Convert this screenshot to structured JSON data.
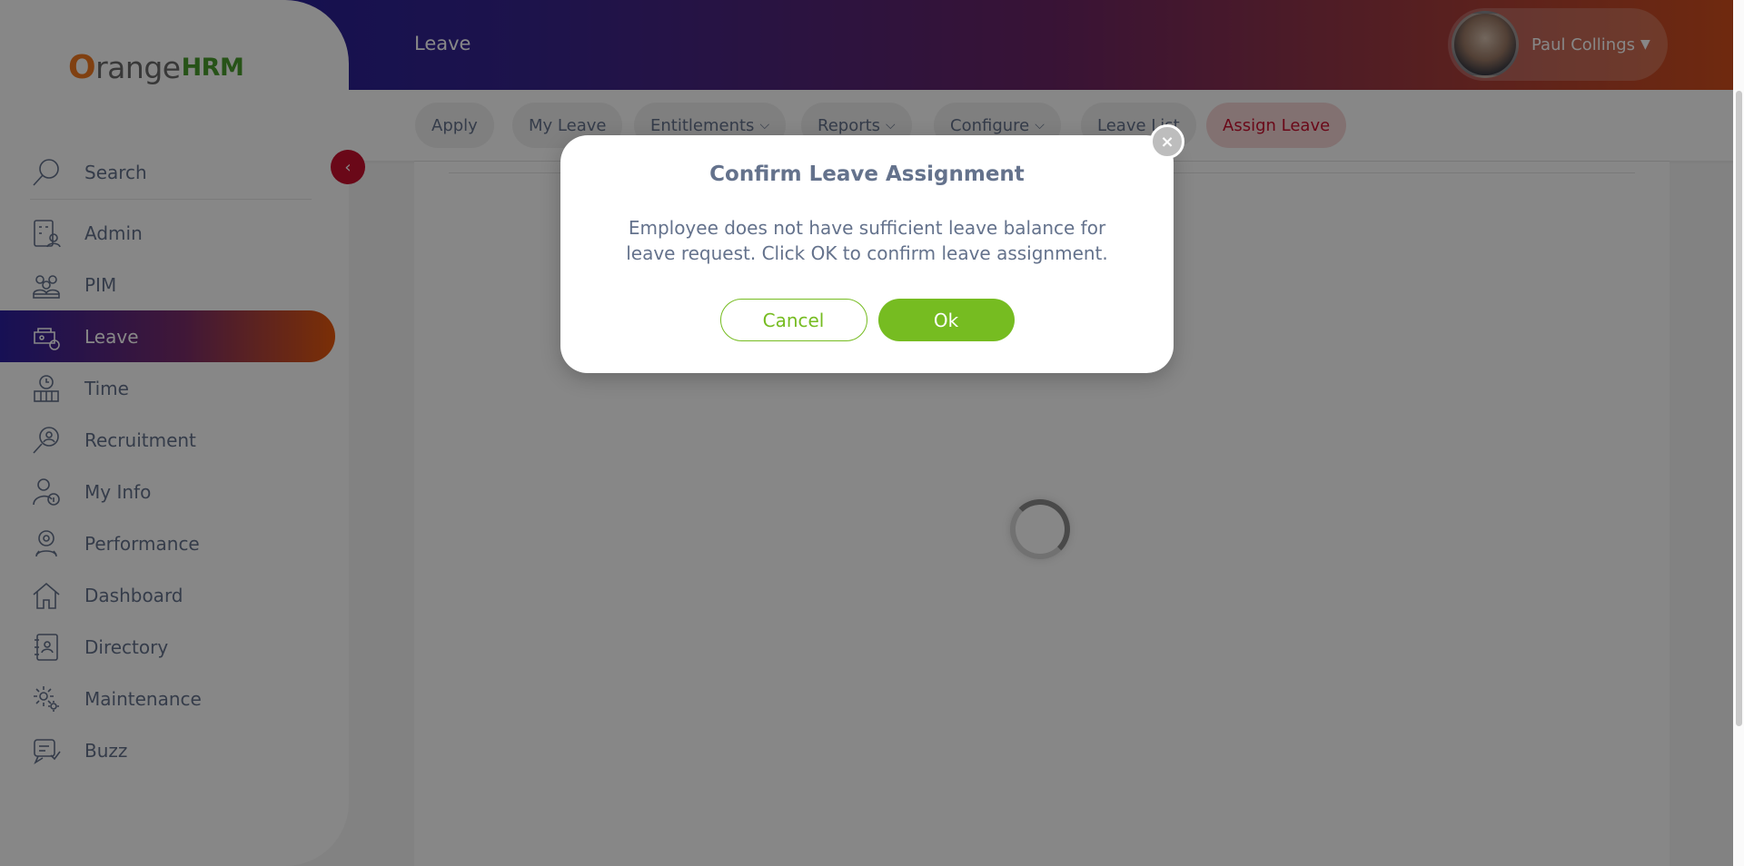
{
  "app": {
    "logo_prefix": "O",
    "logo_text": "range",
    "logo_suffix": "HRM"
  },
  "header": {
    "title": "Leave",
    "user_name": "Paul Collings"
  },
  "sidebar": {
    "search_label": "Search",
    "items": [
      {
        "label": "Admin",
        "icon": "admin-icon"
      },
      {
        "label": "PIM",
        "icon": "pim-icon"
      },
      {
        "label": "Leave",
        "icon": "leave-icon"
      },
      {
        "label": "Time",
        "icon": "time-icon"
      },
      {
        "label": "Recruitment",
        "icon": "recruitment-icon"
      },
      {
        "label": "My Info",
        "icon": "my-info-icon"
      },
      {
        "label": "Performance",
        "icon": "performance-icon"
      },
      {
        "label": "Dashboard",
        "icon": "dashboard-icon"
      },
      {
        "label": "Directory",
        "icon": "directory-icon"
      },
      {
        "label": "Maintenance",
        "icon": "maintenance-icon"
      },
      {
        "label": "Buzz",
        "icon": "buzz-icon"
      }
    ]
  },
  "subnav": {
    "tabs": [
      {
        "label": "Apply"
      },
      {
        "label": "My Leave"
      },
      {
        "label": "Entitlements"
      },
      {
        "label": "Reports"
      },
      {
        "label": "Configure"
      },
      {
        "label": "Leave List"
      },
      {
        "label": "Assign Leave"
      }
    ]
  },
  "modal": {
    "title": "Confirm Leave Assignment",
    "body": "Employee does not have sufficient leave balance for leave request. Click OK to confirm leave assignment.",
    "cancel_label": "Cancel",
    "ok_label": "Ok",
    "close_symbol": "×"
  },
  "colors": {
    "accent": "#76bc21",
    "active_tab": "#c8102e",
    "text": "#64728c"
  }
}
